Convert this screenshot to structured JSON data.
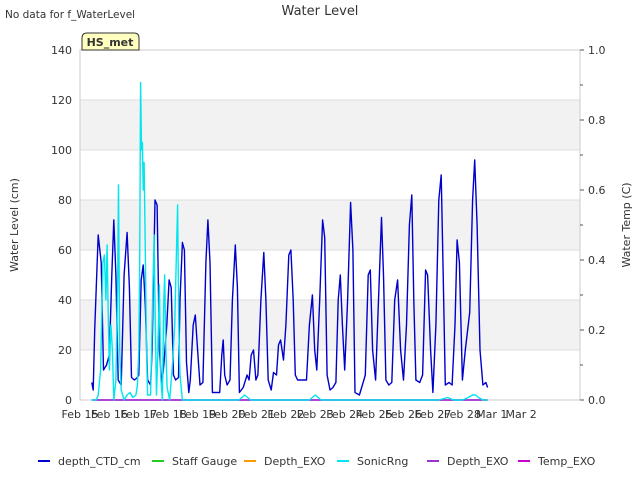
{
  "header": {
    "nodata_note": "No data for f_WaterLevel",
    "badge": "HS_met"
  },
  "colors": {
    "depth_ctd": "#0000cc",
    "staff_gauge": "#22cc22",
    "depth_exo_orange": "#ff9900",
    "sonicrng": "#00e5ee",
    "depth_exo_purple": "#9933cc",
    "temp_exo": "#cc00cc",
    "badge_fill": "#ffffc0",
    "badge_text": "#8b0000",
    "band": "#f2f2f2"
  },
  "chart_data": {
    "type": "line",
    "title": "Water Level",
    "ylabel": "Water Level (cm)",
    "y2label": "Water Temp (C)",
    "ylim": [
      0,
      140
    ],
    "y2lim": [
      0,
      1.0
    ],
    "yticks": [
      "0",
      "20",
      "40",
      "60",
      "80",
      "100",
      "120",
      "140"
    ],
    "y2ticks": [
      "0.0",
      "0.2",
      "0.4",
      "0.6",
      "0.8",
      "1.0"
    ],
    "xlim": [
      15,
      32
    ],
    "xticks": [
      {
        "x": 15,
        "label": "Feb 15"
      },
      {
        "x": 16,
        "label": "Feb 16"
      },
      {
        "x": 17,
        "label": "Feb 17"
      },
      {
        "x": 18,
        "label": "Feb 18"
      },
      {
        "x": 19,
        "label": "Feb 19"
      },
      {
        "x": 20,
        "label": "Feb 20"
      },
      {
        "x": 21,
        "label": "Feb 21"
      },
      {
        "x": 22,
        "label": "Feb 22"
      },
      {
        "x": 23,
        "label": "Feb 23"
      },
      {
        "x": 24,
        "label": "Feb 24"
      },
      {
        "x": 25,
        "label": "Feb 25"
      },
      {
        "x": 26,
        "label": "Feb 26"
      },
      {
        "x": 27,
        "label": "Feb 27"
      },
      {
        "x": 28,
        "label": "Feb 28"
      },
      {
        "x": 29,
        "label": "Mar 1"
      },
      {
        "x": 30,
        "label": "Mar 2"
      }
    ],
    "legend_position": "bottom",
    "series": [
      {
        "name": "depth_CTD_cm",
        "color": "#0000cc",
        "points": [
          [
            15.4,
            7
          ],
          [
            15.45,
            4
          ],
          [
            15.5,
            28
          ],
          [
            15.62,
            66
          ],
          [
            15.72,
            55
          ],
          [
            15.8,
            12
          ],
          [
            15.9,
            14
          ],
          [
            16.0,
            18
          ],
          [
            16.08,
            50
          ],
          [
            16.15,
            72
          ],
          [
            16.22,
            50
          ],
          [
            16.3,
            8
          ],
          [
            16.4,
            6
          ],
          [
            16.5,
            50
          ],
          [
            16.6,
            67
          ],
          [
            16.68,
            45
          ],
          [
            16.75,
            9
          ],
          [
            16.85,
            8
          ],
          [
            16.95,
            9
          ],
          [
            17.0,
            10
          ],
          [
            17.08,
            48
          ],
          [
            17.15,
            54
          ],
          [
            17.22,
            38
          ],
          [
            17.3,
            8
          ],
          [
            17.4,
            6
          ],
          [
            17.45,
            20
          ],
          [
            17.55,
            80
          ],
          [
            17.62,
            78
          ],
          [
            17.7,
            20
          ],
          [
            17.78,
            6
          ],
          [
            17.85,
            14
          ],
          [
            17.95,
            30
          ],
          [
            18.03,
            48
          ],
          [
            18.1,
            45
          ],
          [
            18.18,
            10
          ],
          [
            18.25,
            8
          ],
          [
            18.35,
            9
          ],
          [
            18.4,
            40
          ],
          [
            18.48,
            63
          ],
          [
            18.55,
            60
          ],
          [
            18.62,
            15
          ],
          [
            18.7,
            3
          ],
          [
            18.75,
            8
          ],
          [
            18.85,
            30
          ],
          [
            18.92,
            34
          ],
          [
            19.0,
            20
          ],
          [
            19.08,
            6
          ],
          [
            19.18,
            7
          ],
          [
            19.28,
            55
          ],
          [
            19.35,
            72
          ],
          [
            19.42,
            55
          ],
          [
            19.5,
            3
          ],
          [
            19.6,
            3
          ],
          [
            19.75,
            3
          ],
          [
            19.82,
            18
          ],
          [
            19.87,
            24
          ],
          [
            19.92,
            10
          ],
          [
            20.0,
            6
          ],
          [
            20.1,
            8
          ],
          [
            20.18,
            40
          ],
          [
            20.28,
            62
          ],
          [
            20.35,
            45
          ],
          [
            20.42,
            3
          ],
          [
            20.55,
            5
          ],
          [
            20.68,
            10
          ],
          [
            20.75,
            8
          ],
          [
            20.82,
            18
          ],
          [
            20.9,
            20
          ],
          [
            20.98,
            8
          ],
          [
            21.05,
            10
          ],
          [
            21.15,
            40
          ],
          [
            21.25,
            59
          ],
          [
            21.32,
            40
          ],
          [
            21.4,
            8
          ],
          [
            21.5,
            4
          ],
          [
            21.58,
            11
          ],
          [
            21.68,
            10
          ],
          [
            21.75,
            22
          ],
          [
            21.82,
            24
          ],
          [
            21.92,
            16
          ],
          [
            22.0,
            30
          ],
          [
            22.1,
            58
          ],
          [
            22.17,
            60
          ],
          [
            22.25,
            40
          ],
          [
            22.32,
            10
          ],
          [
            22.4,
            8
          ],
          [
            22.5,
            8
          ],
          [
            22.6,
            8
          ],
          [
            22.7,
            8
          ],
          [
            22.8,
            30
          ],
          [
            22.9,
            42
          ],
          [
            22.98,
            20
          ],
          [
            23.05,
            12
          ],
          [
            23.15,
            40
          ],
          [
            23.25,
            72
          ],
          [
            23.32,
            65
          ],
          [
            23.4,
            10
          ],
          [
            23.5,
            4
          ],
          [
            23.6,
            5
          ],
          [
            23.7,
            7
          ],
          [
            23.78,
            40
          ],
          [
            23.85,
            50
          ],
          [
            23.92,
            30
          ],
          [
            24.0,
            12
          ],
          [
            24.1,
            40
          ],
          [
            24.2,
            79
          ],
          [
            24.28,
            60
          ],
          [
            24.35,
            3
          ],
          [
            24.5,
            2
          ],
          [
            24.6,
            6
          ],
          [
            24.7,
            10
          ],
          [
            24.8,
            50
          ],
          [
            24.87,
            52
          ],
          [
            24.95,
            20
          ],
          [
            25.05,
            8
          ],
          [
            25.15,
            40
          ],
          [
            25.25,
            73
          ],
          [
            25.32,
            50
          ],
          [
            25.4,
            8
          ],
          [
            25.5,
            6
          ],
          [
            25.6,
            7
          ],
          [
            25.7,
            40
          ],
          [
            25.8,
            48
          ],
          [
            25.9,
            20
          ],
          [
            26.0,
            8
          ],
          [
            26.1,
            30
          ],
          [
            26.2,
            70
          ],
          [
            26.28,
            82
          ],
          [
            26.35,
            40
          ],
          [
            26.42,
            8
          ],
          [
            26.55,
            7
          ],
          [
            26.65,
            10
          ],
          [
            26.75,
            52
          ],
          [
            26.82,
            50
          ],
          [
            26.92,
            20
          ],
          [
            27.0,
            3
          ],
          [
            27.1,
            30
          ],
          [
            27.2,
            80
          ],
          [
            27.28,
            90
          ],
          [
            27.35,
            50
          ],
          [
            27.42,
            6
          ],
          [
            27.55,
            7
          ],
          [
            27.65,
            6
          ],
          [
            27.75,
            30
          ],
          [
            27.82,
            64
          ],
          [
            27.9,
            55
          ],
          [
            28.0,
            8
          ],
          [
            28.1,
            20
          ],
          [
            28.25,
            35
          ],
          [
            28.35,
            80
          ],
          [
            28.42,
            96
          ],
          [
            28.5,
            70
          ],
          [
            28.6,
            20
          ],
          [
            28.7,
            6
          ],
          [
            28.8,
            7
          ],
          [
            28.86,
            5
          ]
        ]
      },
      {
        "name": "Staff Gauge",
        "color": "#22cc22",
        "points": []
      },
      {
        "name": "Depth_EXO",
        "color": "#ff9900",
        "points": []
      },
      {
        "name": "SonicRng",
        "color": "#00e5ee",
        "points": [
          [
            15.4,
            0
          ],
          [
            15.55,
            0
          ],
          [
            15.62,
            2
          ],
          [
            15.7,
            12
          ],
          [
            15.78,
            55
          ],
          [
            15.83,
            58
          ],
          [
            15.88,
            40
          ],
          [
            15.92,
            62
          ],
          [
            15.96,
            35
          ],
          [
            16.0,
            12
          ],
          [
            16.05,
            30
          ],
          [
            16.1,
            20
          ],
          [
            16.15,
            0
          ],
          [
            16.22,
            8
          ],
          [
            16.28,
            45
          ],
          [
            16.31,
            86
          ],
          [
            16.35,
            20
          ],
          [
            16.4,
            4
          ],
          [
            16.5,
            0
          ],
          [
            16.6,
            2
          ],
          [
            16.7,
            3
          ],
          [
            16.8,
            1
          ],
          [
            16.9,
            2
          ],
          [
            16.95,
            6
          ],
          [
            17.0,
            20
          ],
          [
            17.03,
            55
          ],
          [
            17.06,
            127
          ],
          [
            17.09,
            100
          ],
          [
            17.12,
            103
          ],
          [
            17.15,
            84
          ],
          [
            17.18,
            95
          ],
          [
            17.22,
            60
          ],
          [
            17.26,
            20
          ],
          [
            17.3,
            2
          ],
          [
            17.4,
            2
          ],
          [
            17.48,
            45
          ],
          [
            17.52,
            66
          ],
          [
            17.56,
            30
          ],
          [
            17.6,
            2
          ],
          [
            17.65,
            20
          ],
          [
            17.7,
            46
          ],
          [
            17.74,
            10
          ],
          [
            17.8,
            0
          ],
          [
            17.85,
            40
          ],
          [
            17.88,
            50
          ],
          [
            17.92,
            20
          ],
          [
            17.96,
            5
          ],
          [
            18.05,
            0
          ],
          [
            18.15,
            15
          ],
          [
            18.22,
            30
          ],
          [
            18.28,
            60
          ],
          [
            18.32,
            78
          ],
          [
            18.36,
            30
          ],
          [
            18.4,
            10
          ],
          [
            18.44,
            5
          ],
          [
            18.48,
            0
          ],
          [
            18.6,
            0
          ],
          [
            18.8,
            0
          ],
          [
            19.0,
            0
          ],
          [
            19.3,
            0
          ],
          [
            19.6,
            0
          ],
          [
            19.9,
            0
          ],
          [
            20.2,
            0
          ],
          [
            20.4,
            0
          ],
          [
            20.5,
            1
          ],
          [
            20.6,
            2
          ],
          [
            20.7,
            1
          ],
          [
            20.8,
            0
          ],
          [
            21.2,
            0
          ],
          [
            21.6,
            0
          ],
          [
            22.0,
            0
          ],
          [
            22.4,
            0
          ],
          [
            22.8,
            0
          ],
          [
            23.0,
            2
          ],
          [
            23.1,
            1
          ],
          [
            23.2,
            0
          ],
          [
            23.6,
            0
          ],
          [
            24.0,
            0
          ],
          [
            24.4,
            0
          ],
          [
            24.8,
            0
          ],
          [
            25.2,
            0
          ],
          [
            25.6,
            0
          ],
          [
            26.0,
            0
          ],
          [
            26.4,
            0
          ],
          [
            26.8,
            0
          ],
          [
            27.2,
            0
          ],
          [
            27.5,
            1
          ],
          [
            27.7,
            0
          ],
          [
            28.0,
            0
          ],
          [
            28.2,
            1
          ],
          [
            28.35,
            2
          ],
          [
            28.45,
            2
          ],
          [
            28.55,
            1
          ],
          [
            28.7,
            0
          ],
          [
            28.86,
            0
          ]
        ]
      },
      {
        "name": "Depth_EXO",
        "color": "#9933cc",
        "points": [
          [
            15.4,
            0
          ],
          [
            28.86,
            0
          ]
        ]
      },
      {
        "name": "Temp_EXO",
        "color": "#cc00cc",
        "points": [
          [
            15.4,
            0
          ],
          [
            28.86,
            0
          ]
        ]
      }
    ]
  }
}
